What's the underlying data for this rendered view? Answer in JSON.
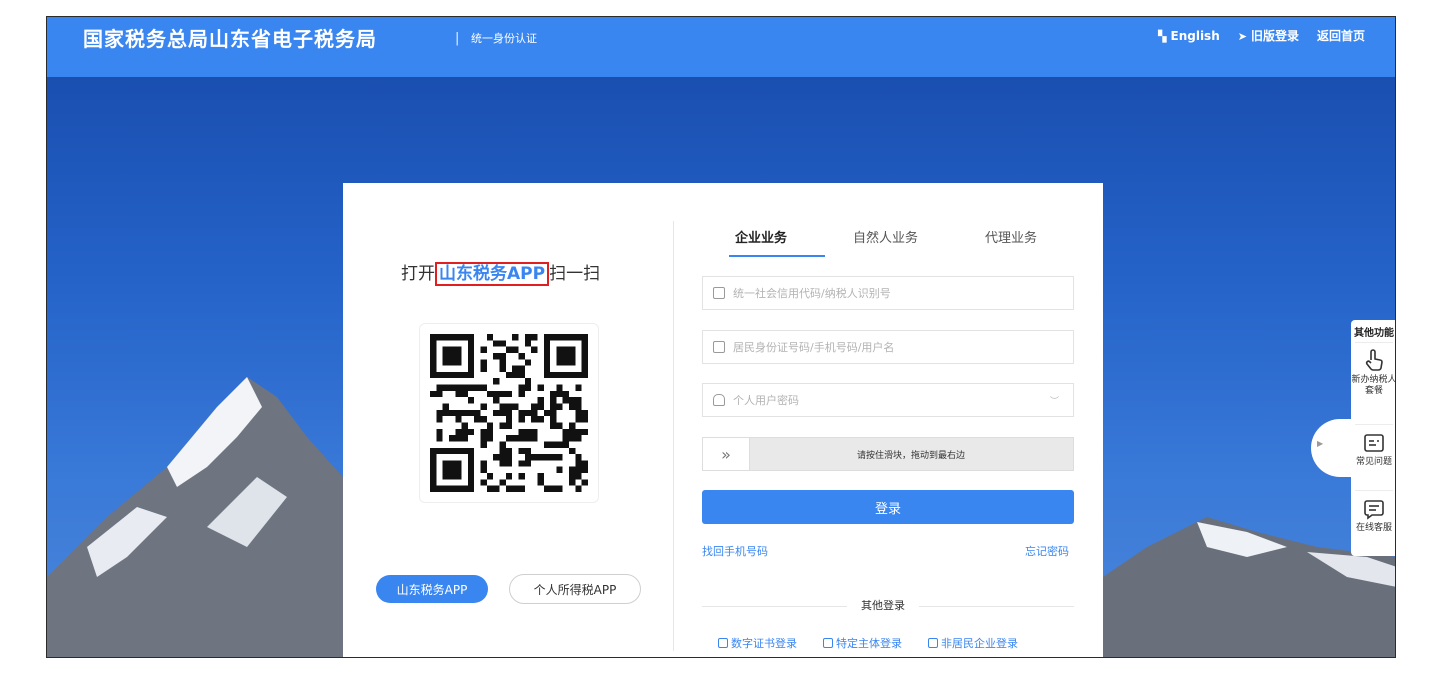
{
  "header": {
    "brand": "国家税务总局山东省电子税务局",
    "separator": "|",
    "subtitle": "统一身份认证",
    "links": [
      {
        "icon": "translate-icon",
        "label": "English"
      },
      {
        "icon": "send-icon",
        "label": "旧版登录"
      },
      {
        "label": "返回首页"
      }
    ]
  },
  "qr_panel": {
    "prefix": "打开",
    "highlight": "山东税务APP",
    "suffix": "扫一扫",
    "app_buttons": [
      "山东税务APP",
      "个人所得税APP"
    ]
  },
  "login": {
    "tabs": [
      {
        "label": "企业业务",
        "active": true
      },
      {
        "label": "自然人业务",
        "active": false
      },
      {
        "label": "代理业务",
        "active": false
      }
    ],
    "fields": {
      "credit_code_placeholder": "统一社会信用代码/纳税人识别号",
      "user_placeholder": "居民身份证号码/手机号码/用户名",
      "password_placeholder": "个人用户密码"
    },
    "slider_text": "请按住滑块，拖动到最右边",
    "submit": "登录",
    "find_phone": "找回手机号码",
    "forgot_password": "忘记密码",
    "other_login_label": "其他登录",
    "other_logins": [
      "数字证书登录",
      "特定主体登录",
      "非居民企业登录"
    ]
  },
  "side_panel": {
    "title": "其他功能",
    "items": [
      {
        "icon": "hand-pointer-icon",
        "label_line1": "新办纳税人",
        "label_line2": "套餐"
      },
      {
        "icon": "faq-icon",
        "label_line1": "常见问题"
      },
      {
        "icon": "chat-icon",
        "label_line1": "在线客服"
      }
    ]
  },
  "colors": {
    "accent": "#3a86f0",
    "highlight_border": "#e02020"
  }
}
